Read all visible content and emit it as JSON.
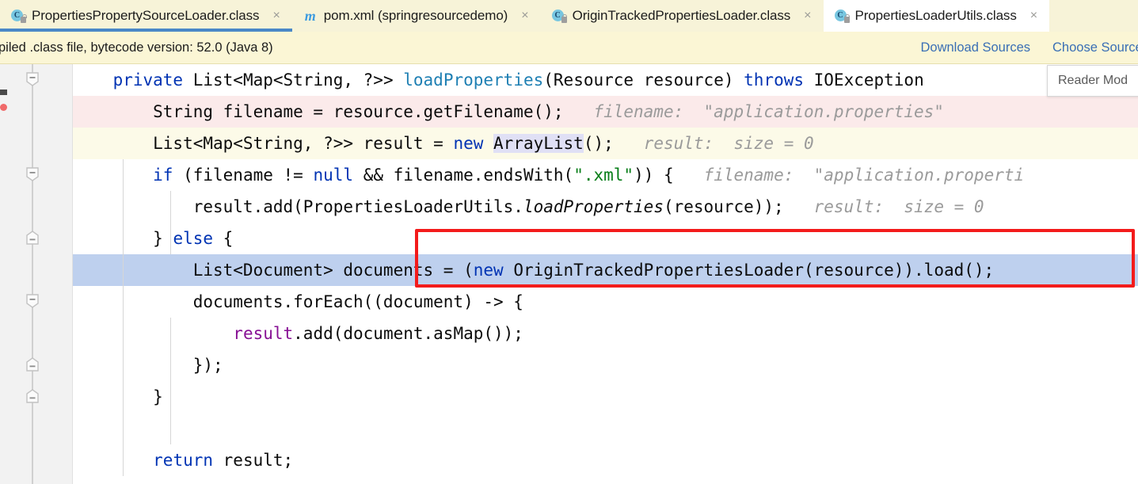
{
  "window": {
    "app": "IntelliJ IDEA",
    "theme_colors": {
      "tab_bar_bg": "#f7f3d8",
      "banner_bg": "#fbf6d5",
      "link_blue": "#3a6fb5",
      "selection_blue": "#bed0ee",
      "error_line_pink": "#fbeaea",
      "warning_line_yellow": "#fcfae8",
      "annotation_red": "#f31b1b",
      "keyword_blue": "#0033b3",
      "method_teal": "#1e7fb3",
      "string_green": "#067d17",
      "field_purple": "#871094",
      "hint_gray": "#9a9a9a"
    }
  },
  "tabs": [
    {
      "label": "PropertiesPropertySourceLoader.class",
      "icon": "java-class-decompiled-icon",
      "icon_letter": "C",
      "state": "selected",
      "closable": true
    },
    {
      "label": "pom.xml (springresourcedemo)",
      "icon": "maven-pom-icon",
      "icon_letter": "m",
      "state": "normal",
      "closable": true
    },
    {
      "label": "OriginTrackedPropertiesLoader.class",
      "icon": "java-class-decompiled-icon",
      "icon_letter": "C",
      "state": "normal",
      "closable": true
    },
    {
      "label": "PropertiesLoaderUtils.class",
      "icon": "java-class-decompiled-icon",
      "icon_letter": "C",
      "state": "hovered",
      "closable": true
    }
  ],
  "banner": {
    "message": "piled .class file, bytecode version: 52.0 (Java 8)",
    "actions": [
      {
        "label": "Download Sources"
      },
      {
        "label": "Choose Sources"
      }
    ]
  },
  "reader_hint": {
    "label": "Reader Mod"
  },
  "editor": {
    "lines": [
      {
        "id": 1,
        "background": "none",
        "fold": "collapse-expanded",
        "segments": [
          {
            "t": "    ",
            "c": "plain"
          },
          {
            "t": "private",
            "c": "kw"
          },
          {
            "t": " List<Map<String, ?>> ",
            "c": "plain"
          },
          {
            "t": "loadProperties",
            "c": "mth"
          },
          {
            "t": "(Resource resource) ",
            "c": "plain"
          },
          {
            "t": "throws",
            "c": "kw"
          },
          {
            "t": " IOException",
            "c": "plain"
          }
        ]
      },
      {
        "id": 2,
        "background": "bg-pink",
        "fold": null,
        "segments": [
          {
            "t": "        String filename = resource.getFilename();",
            "c": "plain"
          },
          {
            "t": "   filename:  \"application.properties\"",
            "c": "hint"
          }
        ]
      },
      {
        "id": 3,
        "background": "bg-yellow",
        "fold": null,
        "segments": [
          {
            "t": "        List<Map<String, ?>> result = ",
            "c": "plain"
          },
          {
            "t": "new",
            "c": "kw"
          },
          {
            "t": " ",
            "c": "plain"
          },
          {
            "t": "ArrayList",
            "c": "plain ident-hl"
          },
          {
            "t": "();",
            "c": "plain"
          },
          {
            "t": "   result:  size = 0",
            "c": "hint"
          }
        ]
      },
      {
        "id": 4,
        "background": "none",
        "fold": "collapse-expanded",
        "segments": [
          {
            "t": "        ",
            "c": "plain"
          },
          {
            "t": "if",
            "c": "kw"
          },
          {
            "t": " (filename != ",
            "c": "plain"
          },
          {
            "t": "null",
            "c": "kw"
          },
          {
            "t": " && filename.endsWith(",
            "c": "plain"
          },
          {
            "t": "\".xml\"",
            "c": "str"
          },
          {
            "t": ")) {",
            "c": "plain"
          },
          {
            "t": "   filename:  \"application.properti",
            "c": "hint"
          }
        ]
      },
      {
        "id": 5,
        "background": "none",
        "fold": null,
        "segments": [
          {
            "t": "            result.add(PropertiesLoaderUtils.",
            "c": "plain"
          },
          {
            "t": "loadProperties",
            "c": "plain stat"
          },
          {
            "t": "(resource));",
            "c": "plain"
          },
          {
            "t": "   result:  size = 0",
            "c": "hint"
          }
        ]
      },
      {
        "id": 6,
        "background": "none",
        "fold": "collapse-end",
        "segments": [
          {
            "t": "        } ",
            "c": "plain"
          },
          {
            "t": "else",
            "c": "kw"
          },
          {
            "t": " {",
            "c": "plain"
          }
        ]
      },
      {
        "id": 7,
        "background": "bg-select",
        "fold": null,
        "highlighted": true,
        "segments": [
          {
            "t": "            List<Document> documents = (",
            "c": "plain"
          },
          {
            "t": "new",
            "c": "kw"
          },
          {
            "t": " OriginTrackedPropertiesLoader(resource)).load();",
            "c": "plain"
          }
        ]
      },
      {
        "id": 8,
        "background": "none",
        "fold": "collapse-expanded",
        "segments": [
          {
            "t": "            documents.forEach((document) -> {",
            "c": "plain"
          }
        ]
      },
      {
        "id": 9,
        "background": "none",
        "fold": null,
        "segments": [
          {
            "t": "                ",
            "c": "plain"
          },
          {
            "t": "result",
            "c": "fld"
          },
          {
            "t": ".add(document.asMap());",
            "c": "plain"
          }
        ]
      },
      {
        "id": 10,
        "background": "none",
        "fold": "collapse-end",
        "segments": [
          {
            "t": "            });",
            "c": "plain"
          }
        ]
      },
      {
        "id": 11,
        "background": "none",
        "fold": "collapse-end",
        "segments": [
          {
            "t": "        }",
            "c": "plain"
          }
        ]
      },
      {
        "id": 12,
        "background": "none",
        "fold": null,
        "segments": [
          {
            "t": "",
            "c": "plain"
          }
        ]
      },
      {
        "id": 13,
        "background": "none",
        "fold": null,
        "segments": [
          {
            "t": "        ",
            "c": "plain"
          },
          {
            "t": "return",
            "c": "kw"
          },
          {
            "t": " result;",
            "c": "plain"
          }
        ]
      }
    ],
    "annotation": {
      "type": "red-rectangle-highlight",
      "target_line": 7,
      "target_text": "(new OriginTrackedPropertiesLoader(resource)).load();"
    }
  }
}
